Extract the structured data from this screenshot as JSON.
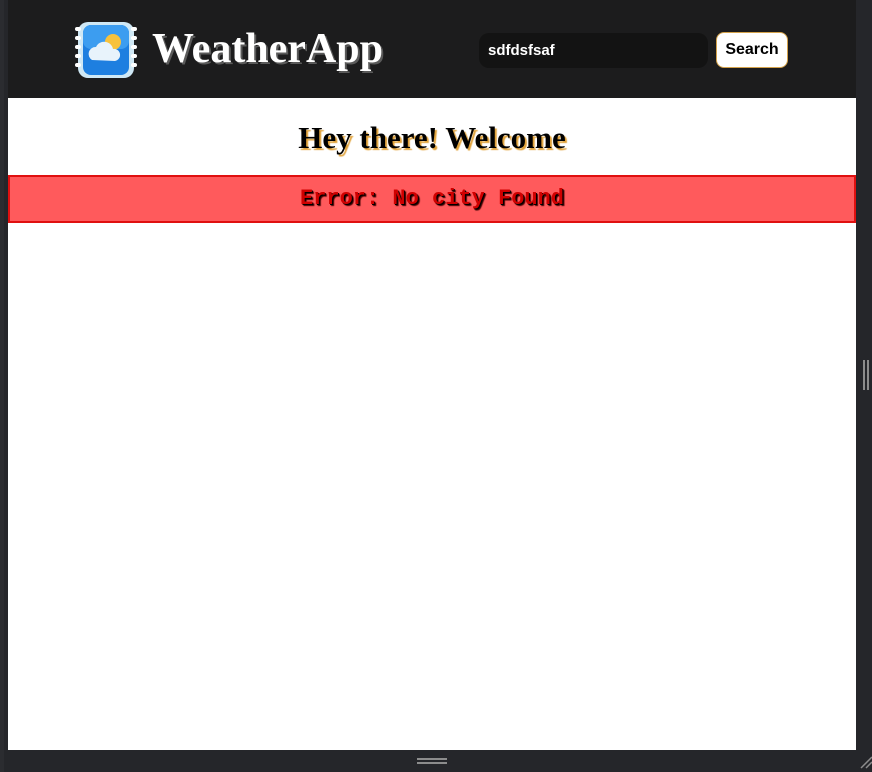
{
  "header": {
    "brand": "WeatherApp",
    "logo_icon": "weather-app-icon"
  },
  "search": {
    "value": "sdfdsfsaf",
    "placeholder": "",
    "button_label": "Search"
  },
  "main": {
    "welcome": "Hey there! Welcome",
    "error": "Error: No city Found"
  },
  "colors": {
    "navbar_bg": "#1c1c1d",
    "error_bg": "#ff5a5c",
    "error_border": "#e01010",
    "error_text": "#d00000",
    "welcome_shadow": "#e0a23a"
  }
}
